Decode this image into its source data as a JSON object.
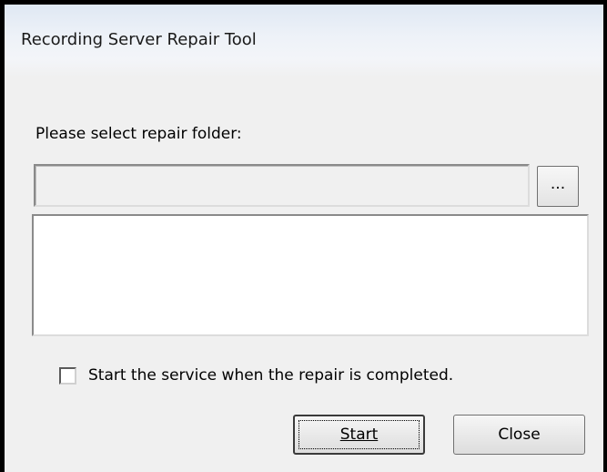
{
  "window": {
    "title": "Recording Server Repair Tool"
  },
  "main": {
    "prompt_label": "Please select repair folder:",
    "folder_path": {
      "value": "",
      "placeholder": ""
    },
    "browse_button_label": "...",
    "log_text": ""
  },
  "options": {
    "start_service_checked": false,
    "start_service_label": "Start the service when the repair is completed."
  },
  "buttons": {
    "start_label": "Start",
    "close_label": "Close"
  }
}
